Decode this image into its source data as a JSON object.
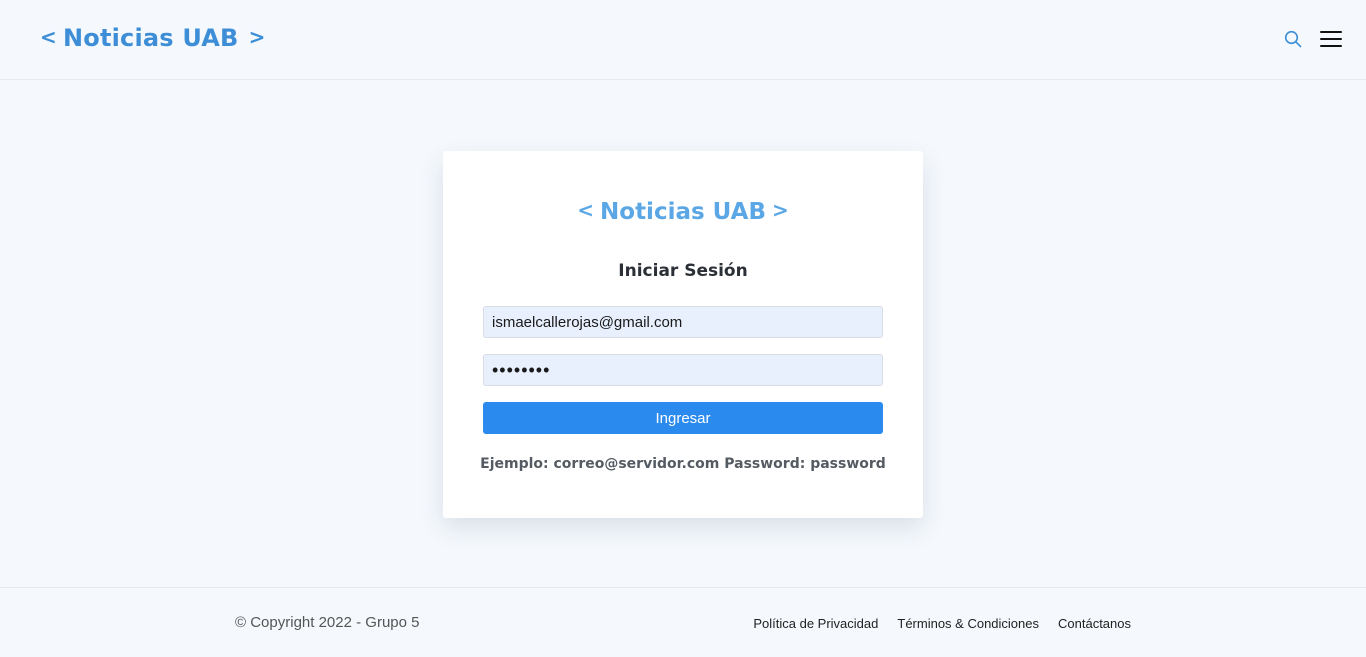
{
  "header": {
    "brand_left": "<",
    "brand_text": "Noticias UAB",
    "brand_right": ">",
    "icons": [
      "search-icon",
      "menu-icon"
    ]
  },
  "login": {
    "brand_left": "<",
    "brand_text": "Noticias UAB",
    "brand_right": ">",
    "title": "Iniciar Sesión",
    "email_value": "ismaelcallerojas@gmail.com",
    "password_value": "••••••••",
    "submit_label": "Ingresar",
    "hint": "Ejemplo: correo@servidor.com Password: password"
  },
  "footer": {
    "copyright": "© Copyright 2022 - Grupo 5",
    "links": [
      {
        "label": "Política de Privacidad"
      },
      {
        "label": "Términos & Condiciones"
      },
      {
        "label": "Contáctanos"
      }
    ]
  },
  "colors": {
    "brand": "#3d8ed7",
    "brand_light": "#5ba7e6",
    "button": "#2b8aee",
    "background": "#f5f9fd"
  }
}
